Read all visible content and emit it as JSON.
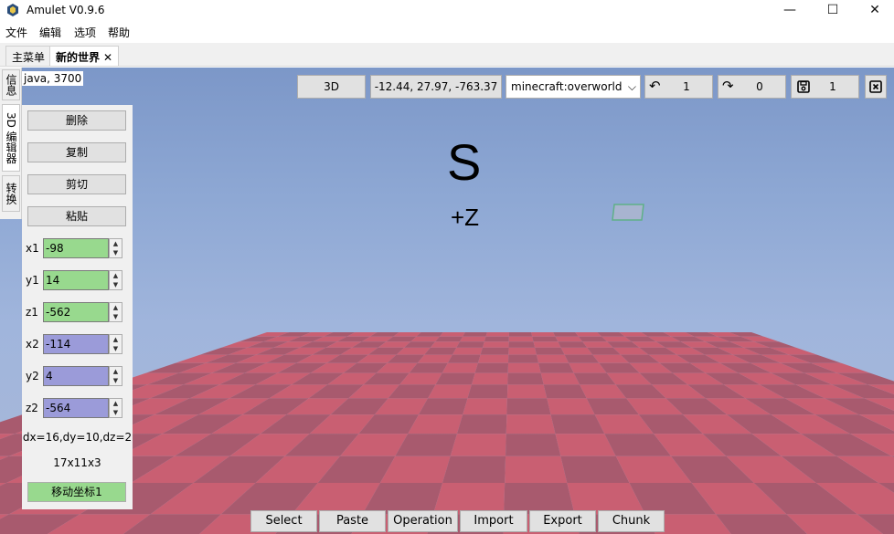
{
  "window": {
    "title": "Amulet V0.9.6",
    "minimize": "—",
    "maximize": "☐",
    "close": "✕"
  },
  "menu": [
    "文件",
    "编辑",
    "选项",
    "帮助"
  ],
  "tabs": [
    {
      "label": "主菜单"
    },
    {
      "label": "新的世界",
      "close": "✕"
    }
  ],
  "side_tabs": [
    "信息",
    "3D 编辑器",
    "转换"
  ],
  "info": "java, 3700",
  "toolbar": {
    "view_mode": "3D",
    "coordinates": "-12.44, 27.97, -763.37",
    "dimension": "minecraft:overworld",
    "undo_count": "1",
    "redo_count": "0",
    "save_count": "1"
  },
  "compass": {
    "letter": "S",
    "axis": "+Z"
  },
  "panel": {
    "delete": "删除",
    "copy": "复制",
    "cut": "剪切",
    "paste": "粘贴",
    "fields": [
      {
        "label": "x1",
        "value": "-98",
        "color": "#98d98e"
      },
      {
        "label": "y1",
        "value": "14",
        "color": "#98d98e"
      },
      {
        "label": "z1",
        "value": "-562",
        "color": "#98d98e"
      },
      {
        "label": "x2",
        "value": "-114",
        "color": "#9b9bd9"
      },
      {
        "label": "y2",
        "value": "4",
        "color": "#9b9bd9"
      },
      {
        "label": "z2",
        "value": "-564",
        "color": "#9b9bd9"
      }
    ],
    "delta": "dx=16,dy=10,dz=2",
    "size": "17x11x3",
    "move": "移动坐标1"
  },
  "bottom_tools": [
    "Select",
    "Paste",
    "Operation",
    "Import",
    "Export",
    "Chunk"
  ],
  "colors": {
    "sky_top": "#7c97c8",
    "floor_light": "#c95f72",
    "floor_dark": "#a85a6e",
    "point1": "#98d98e",
    "point2": "#9b9bd9"
  }
}
